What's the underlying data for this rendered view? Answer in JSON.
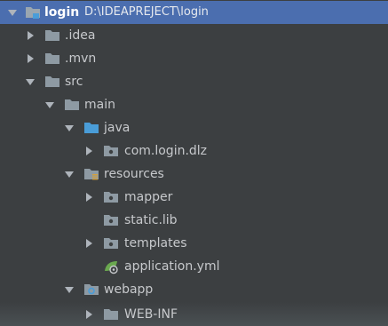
{
  "tree": {
    "root": {
      "name": "login",
      "path": "D:\\IDEAPREJECT\\login"
    },
    "items": [
      {
        "label": "idea",
        "display": ".idea"
      },
      {
        "label": "mvn",
        "display": ".mvn"
      },
      {
        "label": "src",
        "display": "src"
      },
      {
        "label": "main",
        "display": "main"
      },
      {
        "label": "java",
        "display": "java"
      },
      {
        "label": "package",
        "display": "com.login.dlz"
      },
      {
        "label": "resources",
        "display": "resources"
      },
      {
        "label": "mapper",
        "display": "mapper"
      },
      {
        "label": "static",
        "display": "static.lib"
      },
      {
        "label": "templates",
        "display": "templates"
      },
      {
        "label": "appyml",
        "display": "application.yml"
      },
      {
        "label": "webapp",
        "display": "webapp"
      },
      {
        "label": "webinf",
        "display": "WEB-INF"
      }
    ]
  },
  "colors": {
    "background": "#3c3f41",
    "selection": "#4b6eaf",
    "folder": "#8e9aa3",
    "source_folder": "#4a9dd8",
    "spring_green": "#6aa84f"
  },
  "icons": {
    "expanded": "chevron-down-icon",
    "collapsed": "chevron-right-icon",
    "folder": "folder-icon",
    "module": "module-folder-icon",
    "source": "source-folder-icon",
    "resources": "resources-folder-icon",
    "package": "package-folder-icon",
    "spring": "spring-config-icon",
    "web": "web-folder-icon"
  }
}
